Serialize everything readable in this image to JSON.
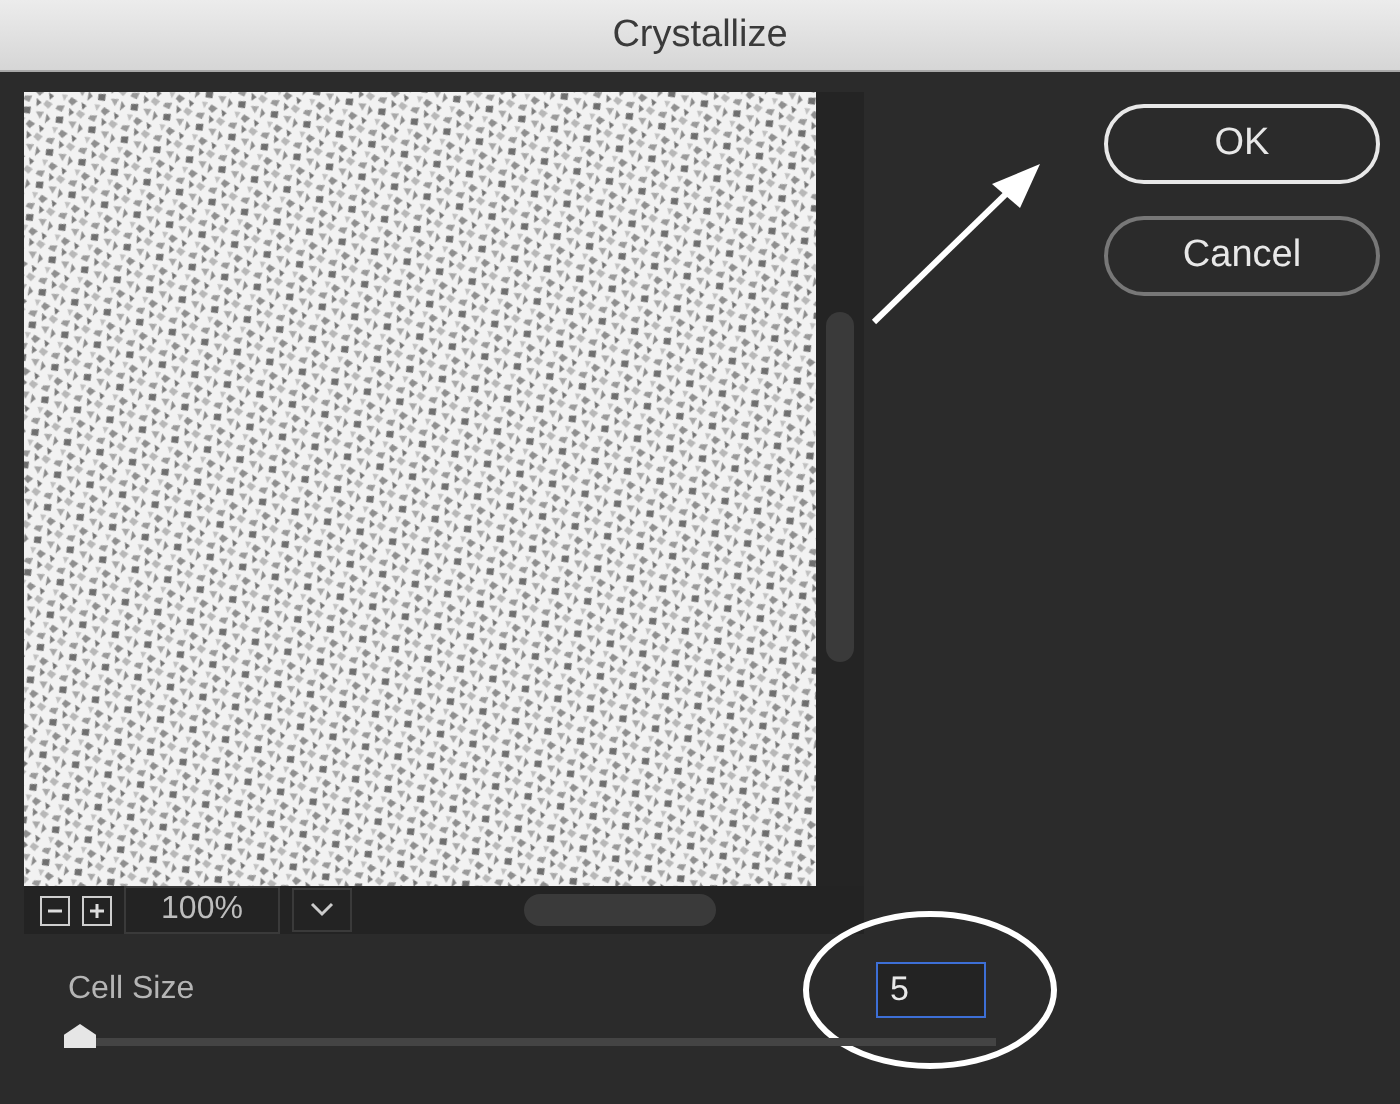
{
  "window": {
    "title": "Crystallize"
  },
  "preview": {
    "kind": "picture",
    "zoom": "100%"
  },
  "cell_size": {
    "label": "Cell Size",
    "value": "5",
    "level": 0
  },
  "buttons": [
    {
      "label": "OK",
      "default": true
    },
    {
      "label": "Cancel",
      "default": false
    }
  ]
}
